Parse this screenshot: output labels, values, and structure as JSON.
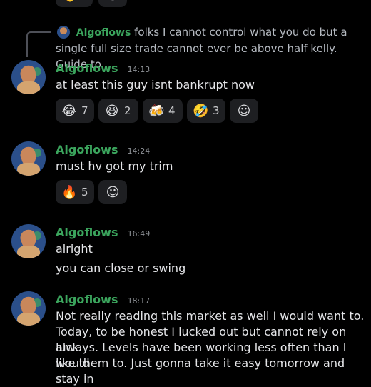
{
  "top_partial_reactions": [
    {
      "emoji": "👌",
      "count": ""
    },
    {
      "emoji": "☺",
      "count": ""
    }
  ],
  "reply": {
    "author": "Algoflows",
    "text": "folks I cannot control what you do but a single full size trade cannot ever be above half kelly. Guide to ..."
  },
  "messages": [
    {
      "author": "Algoflows",
      "time": "14:13",
      "lines": [
        "at least this guy isnt bankrupt now"
      ],
      "reactions": [
        {
          "emoji": "😂",
          "count": "7"
        },
        {
          "emoji": "😆",
          "count": "2"
        },
        {
          "emoji": "🍻",
          "count": "4"
        },
        {
          "emoji": "🤣",
          "count": "3"
        }
      ]
    },
    {
      "author": "Algoflows",
      "time": "14:24",
      "lines": [
        "must hv got my trim"
      ],
      "reactions": [
        {
          "emoji": "🔥",
          "count": "5"
        }
      ]
    },
    {
      "author": "Algoflows",
      "time": "16:49",
      "lines": [
        "alright",
        "you can close or swing"
      ],
      "reactions": []
    },
    {
      "author": "Algoflows",
      "time": "18:17",
      "lines": [
        "Not really reading this market as well I would want to.",
        "Today, to be honest I lucked out but cannot rely on luck",
        "always. Levels have been working less often than I would",
        "like them to. Just gonna take it easy tomorrow and stay in"
      ],
      "reactions": []
    }
  ]
}
